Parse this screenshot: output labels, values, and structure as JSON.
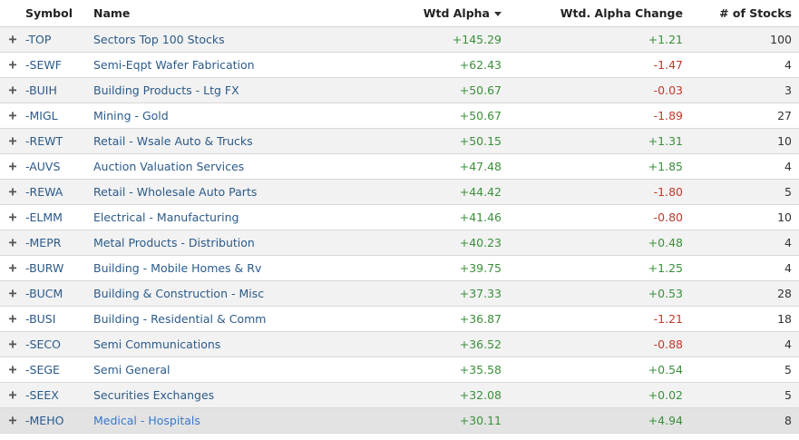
{
  "columns": {
    "symbol": "Symbol",
    "name": "Name",
    "wtd_alpha": "Wtd Alpha",
    "alpha_change": "Wtd. Alpha Change",
    "num_stocks": "# of Stocks"
  },
  "sort": {
    "column": "wtd_alpha",
    "direction": "desc"
  },
  "colors": {
    "positive": "#3c8f3c",
    "negative": "#c0392b",
    "link": "#2b5a8a",
    "hover_link": "#3a78c9"
  },
  "rows": [
    {
      "symbol": "-TOP",
      "name": "Sectors Top 100 Stocks",
      "alpha": "+145.29",
      "change": "+1.21",
      "count": "100"
    },
    {
      "symbol": "-SEWF",
      "name": "Semi-Eqpt Wafer Fabrication",
      "alpha": "+62.43",
      "change": "-1.47",
      "count": "4"
    },
    {
      "symbol": "-BUIH",
      "name": "Building Products - Ltg FX",
      "alpha": "+50.67",
      "change": "-0.03",
      "count": "3"
    },
    {
      "symbol": "-MIGL",
      "name": "Mining - Gold",
      "alpha": "+50.67",
      "change": "-1.89",
      "count": "27"
    },
    {
      "symbol": "-REWT",
      "name": "Retail - Wsale Auto & Trucks",
      "alpha": "+50.15",
      "change": "+1.31",
      "count": "10"
    },
    {
      "symbol": "-AUVS",
      "name": "Auction Valuation Services",
      "alpha": "+47.48",
      "change": "+1.85",
      "count": "4"
    },
    {
      "symbol": "-REWA",
      "name": "Retail - Wholesale Auto Parts",
      "alpha": "+44.42",
      "change": "-1.80",
      "count": "5"
    },
    {
      "symbol": "-ELMM",
      "name": "Electrical - Manufacturing",
      "alpha": "+41.46",
      "change": "-0.80",
      "count": "10"
    },
    {
      "symbol": "-MEPR",
      "name": "Metal Products - Distribution",
      "alpha": "+40.23",
      "change": "+0.48",
      "count": "4"
    },
    {
      "symbol": "-BURW",
      "name": "Building - Mobile Homes & Rv",
      "alpha": "+39.75",
      "change": "+1.25",
      "count": "4"
    },
    {
      "symbol": "-BUCM",
      "name": "Building & Construction - Misc",
      "alpha": "+37.33",
      "change": "+0.53",
      "count": "28"
    },
    {
      "symbol": "-BUSI",
      "name": "Building - Residential & Comm",
      "alpha": "+36.87",
      "change": "-1.21",
      "count": "18"
    },
    {
      "symbol": "-SECO",
      "name": "Semi Communications",
      "alpha": "+36.52",
      "change": "-0.88",
      "count": "4"
    },
    {
      "symbol": "-SEGE",
      "name": "Semi General",
      "alpha": "+35.58",
      "change": "+0.54",
      "count": "5"
    },
    {
      "symbol": "-SEEX",
      "name": "Securities Exchanges",
      "alpha": "+32.08",
      "change": "+0.02",
      "count": "5"
    },
    {
      "symbol": "-MEHO",
      "name": "Medical - Hospitals",
      "alpha": "+30.11",
      "change": "+4.94",
      "count": "8",
      "highlighted": true
    }
  ]
}
